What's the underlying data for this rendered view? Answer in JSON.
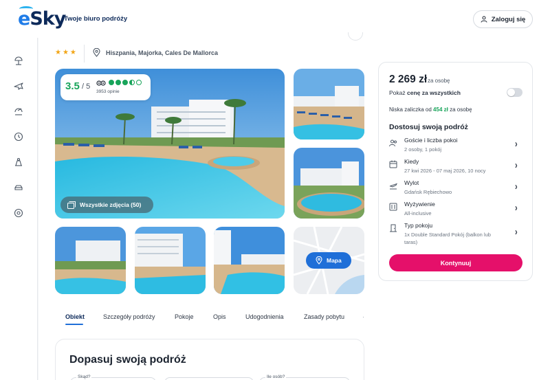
{
  "header": {
    "logo": "eSky",
    "tagline": "Twoje biuro podróży",
    "login_label": "Zaloguj się"
  },
  "sidebar": {
    "items": [
      "beach-umbrella-icon",
      "plane-icon",
      "hotel-plane-icon",
      "clock-icon",
      "tour-icon",
      "car-icon",
      "settings-icon"
    ]
  },
  "hotel": {
    "stars": "★★★",
    "location": "Hiszpania, Majorka, Cales De Mallorca",
    "rating": "3.5",
    "rating_of": "/ 5",
    "rating_dots": 3.5,
    "opinions": "3953 opinie",
    "all_photos_label": "Wszystkie zdjęcia (50)",
    "map_label": "Mapa"
  },
  "tabs": [
    {
      "label": "Obiekt",
      "active": true
    },
    {
      "label": "Szczegóły podróży"
    },
    {
      "label": "Pokoje"
    },
    {
      "label": "Opis"
    },
    {
      "label": "Udogodnienia"
    },
    {
      "label": "Zasady pobytu"
    }
  ],
  "form": {
    "title": "Dopasuj swoją podróż",
    "field_from_label": "Skąd?",
    "field_people_label": "Ile osób?"
  },
  "booking": {
    "price": "2 269 zł",
    "per_person": "za osobę",
    "toggle_prefix": "Pokaż",
    "toggle_bold": "cenę za wszystkich",
    "deposit_prefix": "Niska zaliczka od",
    "deposit_amount": "454 zł",
    "deposit_suffix": "za osobę",
    "customize_title": "Dostosuj swoją podróż",
    "options": [
      {
        "icon": "guests-icon",
        "title": "Goście i liczba pokoi",
        "sub": "2 osoby, 1 pokój"
      },
      {
        "icon": "calendar-icon",
        "title": "Kiedy",
        "sub": "27 kwi 2026 - 07 maj 2026, 10 nocy"
      },
      {
        "icon": "departure-icon",
        "title": "Wylot",
        "sub": "Gdańsk Rębiechowo"
      },
      {
        "icon": "meal-icon",
        "title": "Wyżywienie",
        "sub": "All-inclusive"
      },
      {
        "icon": "room-door-icon",
        "title": "Typ pokoju",
        "sub": "1x Double Standard Pokój (balkon lub taras)"
      }
    ],
    "continue_label": "Kontynuuj"
  },
  "colors": {
    "brand_blue": "#1f6fd8",
    "cta_pink": "#e5106a",
    "rating_green": "#18a45a",
    "star_orange": "#f2a516"
  }
}
